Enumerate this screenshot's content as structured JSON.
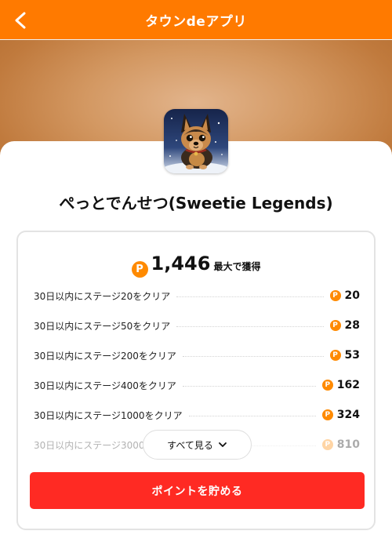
{
  "header": {
    "title": "タウンdeアプリ",
    "back_icon": "chevron-left-icon",
    "background": "#ff7a00"
  },
  "app": {
    "name": "ぺっとでんせつ(Sweetie Legends)",
    "icon": "german-shepherd-puppy-icon"
  },
  "rewards": {
    "coin_symbol": "P",
    "coin_color": "#ff8a00",
    "total": "1,446",
    "total_suffix": "最大で獲得",
    "missions": [
      {
        "label": "30日以内にステージ20をクリア",
        "points": "20"
      },
      {
        "label": "30日以内にステージ50をクリア",
        "points": "28"
      },
      {
        "label": "30日以内にステージ200をクリア",
        "points": "53"
      },
      {
        "label": "30日以内にステージ400をクリア",
        "points": "162"
      },
      {
        "label": "30日以内にステージ1000をクリア",
        "points": "324"
      },
      {
        "label": "30日以内にステージ3000をクリア",
        "points": "810"
      }
    ],
    "see_all_label": "すべて見る"
  },
  "cta": {
    "label": "ポイントを貯める",
    "color": "#ff2a23"
  }
}
